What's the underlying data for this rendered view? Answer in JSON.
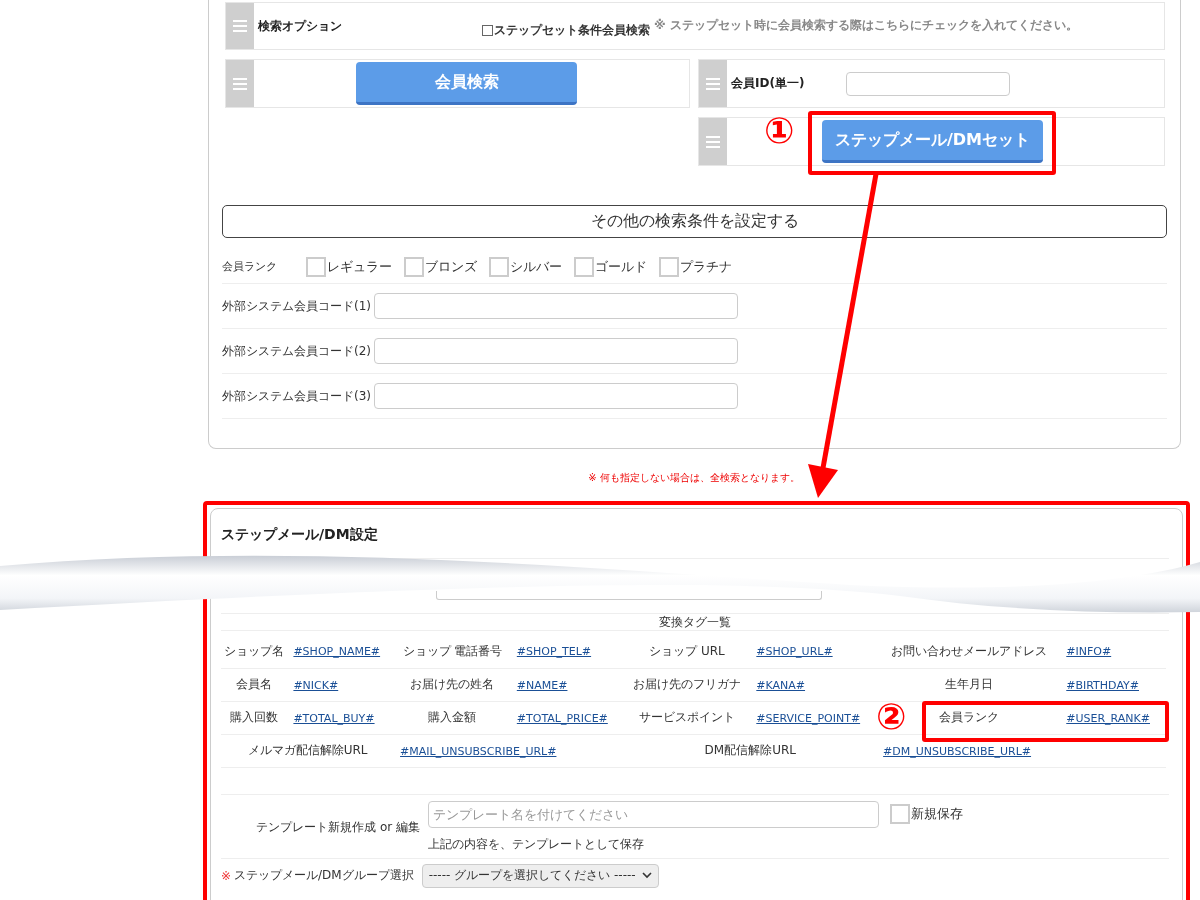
{
  "search_options": {
    "label": "検索オプション",
    "step_set_checkbox": {
      "label": "ステップセット条件会員検索",
      "checked": false
    },
    "note": "※ ステップセット時に会員検索する際はこちらにチェックを入れてください。"
  },
  "member_search_button": "会員検索",
  "member_id": {
    "label": "会員ID(単一)"
  },
  "step_set_button": "ステップメール/DMセット",
  "more_conditions_button": "その他の検索条件を設定する",
  "member_rank": {
    "label": "会員ランク",
    "options": [
      {
        "label": "レギュラー",
        "checked": false
      },
      {
        "label": "ブロンズ",
        "checked": false
      },
      {
        "label": "シルバー",
        "checked": false
      },
      {
        "label": "ゴールド",
        "checked": false
      },
      {
        "label": "プラチナ",
        "checked": false
      }
    ]
  },
  "external_codes": [
    {
      "label": "外部システム会員コード(1)"
    },
    {
      "label": "外部システム会員コード(2)"
    },
    {
      "label": "外部システム会員コード(3)"
    }
  ],
  "notice": "※ 何も指定しない場合は、全検索となります。",
  "step_settings": {
    "title": "ステップメール/DM設定",
    "tags_heading": "変換タグ一覧",
    "tag_rows": [
      {
        "cells": [
          {
            "label": "ショップ名",
            "tag": "#SHOP_NAME#"
          },
          {
            "label": "ショップ 電話番号",
            "tag": "#SHOP_TEL#"
          },
          {
            "label": "ショップ URL",
            "tag": "#SHOP_URL#"
          },
          {
            "label": "お問い合わせメールアドレス",
            "tag": "#INFO#"
          }
        ]
      },
      {
        "cells": [
          {
            "label": "会員名",
            "tag": "#NICK#"
          },
          {
            "label": "お届け先の姓名",
            "tag": "#NAME#"
          },
          {
            "label": "お届け先のフリガナ",
            "tag": "#KANA#"
          },
          {
            "label": "生年月日",
            "tag": "#BIRTHDAY#"
          }
        ]
      },
      {
        "cells": [
          {
            "label": "購入回数",
            "tag": "#TOTAL_BUY#"
          },
          {
            "label": "購入金額",
            "tag": "#TOTAL_PRICE#"
          },
          {
            "label": "サービスポイント",
            "tag": "#SERVICE_POINT#"
          },
          {
            "label": "会員ランク",
            "tag": "#USER_RANK#"
          }
        ]
      },
      {
        "cells": [
          {
            "label": "メルマガ配信解除URL",
            "tag": "#MAIL_UNSUBSCRIBE_URL#"
          },
          {
            "label": "DM配信解除URL",
            "tag": "#DM_UNSUBSCRIBE_URL#"
          }
        ]
      }
    ],
    "template": {
      "label": "テンプレート新規作成 or 編集",
      "placeholder": "テンプレート名を付けてください",
      "save_new": {
        "label": "新規保存",
        "checked": false
      },
      "hint": "上記の内容を、テンプレートとして保存"
    },
    "group_select": {
      "required_mark": "※",
      "label": "ステップメール/DMグループ選択",
      "value": "----- グループを選択してください -----"
    }
  },
  "annotations": [
    {
      "number": "①"
    },
    {
      "number": "②"
    }
  ]
}
